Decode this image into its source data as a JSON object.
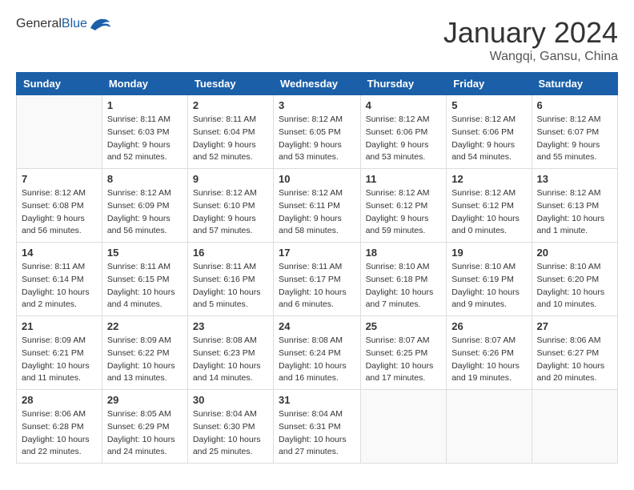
{
  "header": {
    "logo_general": "General",
    "logo_blue": "Blue",
    "title": "January 2024",
    "subtitle": "Wangqi, Gansu, China"
  },
  "days_of_week": [
    "Sunday",
    "Monday",
    "Tuesday",
    "Wednesday",
    "Thursday",
    "Friday",
    "Saturday"
  ],
  "weeks": [
    [
      {
        "num": "",
        "info": ""
      },
      {
        "num": "1",
        "info": "Sunrise: 8:11 AM\nSunset: 6:03 PM\nDaylight: 9 hours\nand 52 minutes."
      },
      {
        "num": "2",
        "info": "Sunrise: 8:11 AM\nSunset: 6:04 PM\nDaylight: 9 hours\nand 52 minutes."
      },
      {
        "num": "3",
        "info": "Sunrise: 8:12 AM\nSunset: 6:05 PM\nDaylight: 9 hours\nand 53 minutes."
      },
      {
        "num": "4",
        "info": "Sunrise: 8:12 AM\nSunset: 6:06 PM\nDaylight: 9 hours\nand 53 minutes."
      },
      {
        "num": "5",
        "info": "Sunrise: 8:12 AM\nSunset: 6:06 PM\nDaylight: 9 hours\nand 54 minutes."
      },
      {
        "num": "6",
        "info": "Sunrise: 8:12 AM\nSunset: 6:07 PM\nDaylight: 9 hours\nand 55 minutes."
      }
    ],
    [
      {
        "num": "7",
        "info": "Sunrise: 8:12 AM\nSunset: 6:08 PM\nDaylight: 9 hours\nand 56 minutes."
      },
      {
        "num": "8",
        "info": "Sunrise: 8:12 AM\nSunset: 6:09 PM\nDaylight: 9 hours\nand 56 minutes."
      },
      {
        "num": "9",
        "info": "Sunrise: 8:12 AM\nSunset: 6:10 PM\nDaylight: 9 hours\nand 57 minutes."
      },
      {
        "num": "10",
        "info": "Sunrise: 8:12 AM\nSunset: 6:11 PM\nDaylight: 9 hours\nand 58 minutes."
      },
      {
        "num": "11",
        "info": "Sunrise: 8:12 AM\nSunset: 6:12 PM\nDaylight: 9 hours\nand 59 minutes."
      },
      {
        "num": "12",
        "info": "Sunrise: 8:12 AM\nSunset: 6:12 PM\nDaylight: 10 hours\nand 0 minutes."
      },
      {
        "num": "13",
        "info": "Sunrise: 8:12 AM\nSunset: 6:13 PM\nDaylight: 10 hours\nand 1 minute."
      }
    ],
    [
      {
        "num": "14",
        "info": "Sunrise: 8:11 AM\nSunset: 6:14 PM\nDaylight: 10 hours\nand 2 minutes."
      },
      {
        "num": "15",
        "info": "Sunrise: 8:11 AM\nSunset: 6:15 PM\nDaylight: 10 hours\nand 4 minutes."
      },
      {
        "num": "16",
        "info": "Sunrise: 8:11 AM\nSunset: 6:16 PM\nDaylight: 10 hours\nand 5 minutes."
      },
      {
        "num": "17",
        "info": "Sunrise: 8:11 AM\nSunset: 6:17 PM\nDaylight: 10 hours\nand 6 minutes."
      },
      {
        "num": "18",
        "info": "Sunrise: 8:10 AM\nSunset: 6:18 PM\nDaylight: 10 hours\nand 7 minutes."
      },
      {
        "num": "19",
        "info": "Sunrise: 8:10 AM\nSunset: 6:19 PM\nDaylight: 10 hours\nand 9 minutes."
      },
      {
        "num": "20",
        "info": "Sunrise: 8:10 AM\nSunset: 6:20 PM\nDaylight: 10 hours\nand 10 minutes."
      }
    ],
    [
      {
        "num": "21",
        "info": "Sunrise: 8:09 AM\nSunset: 6:21 PM\nDaylight: 10 hours\nand 11 minutes."
      },
      {
        "num": "22",
        "info": "Sunrise: 8:09 AM\nSunset: 6:22 PM\nDaylight: 10 hours\nand 13 minutes."
      },
      {
        "num": "23",
        "info": "Sunrise: 8:08 AM\nSunset: 6:23 PM\nDaylight: 10 hours\nand 14 minutes."
      },
      {
        "num": "24",
        "info": "Sunrise: 8:08 AM\nSunset: 6:24 PM\nDaylight: 10 hours\nand 16 minutes."
      },
      {
        "num": "25",
        "info": "Sunrise: 8:07 AM\nSunset: 6:25 PM\nDaylight: 10 hours\nand 17 minutes."
      },
      {
        "num": "26",
        "info": "Sunrise: 8:07 AM\nSunset: 6:26 PM\nDaylight: 10 hours\nand 19 minutes."
      },
      {
        "num": "27",
        "info": "Sunrise: 8:06 AM\nSunset: 6:27 PM\nDaylight: 10 hours\nand 20 minutes."
      }
    ],
    [
      {
        "num": "28",
        "info": "Sunrise: 8:06 AM\nSunset: 6:28 PM\nDaylight: 10 hours\nand 22 minutes."
      },
      {
        "num": "29",
        "info": "Sunrise: 8:05 AM\nSunset: 6:29 PM\nDaylight: 10 hours\nand 24 minutes."
      },
      {
        "num": "30",
        "info": "Sunrise: 8:04 AM\nSunset: 6:30 PM\nDaylight: 10 hours\nand 25 minutes."
      },
      {
        "num": "31",
        "info": "Sunrise: 8:04 AM\nSunset: 6:31 PM\nDaylight: 10 hours\nand 27 minutes."
      },
      {
        "num": "",
        "info": ""
      },
      {
        "num": "",
        "info": ""
      },
      {
        "num": "",
        "info": ""
      }
    ]
  ]
}
